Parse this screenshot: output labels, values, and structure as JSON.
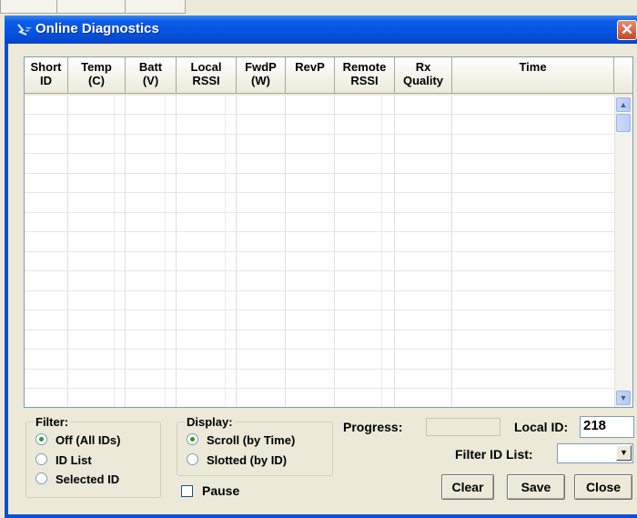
{
  "window": {
    "title": "Online Diagnostics",
    "close_glyph": "✕"
  },
  "table": {
    "columns": [
      {
        "line1": "Short",
        "line2": "ID"
      },
      {
        "line1": "Temp",
        "line2": "(C)"
      },
      {
        "line1": "Batt",
        "line2": "(V)"
      },
      {
        "line1": "Local",
        "line2": "RSSI"
      },
      {
        "line1": "FwdP",
        "line2": "(W)"
      },
      {
        "line1": "RevP",
        "line2": ""
      },
      {
        "line1": "Remote",
        "line2": "RSSI"
      },
      {
        "line1": "Rx",
        "line2": "Quality"
      },
      {
        "line1": "Time",
        "line2": ""
      }
    ],
    "rows": []
  },
  "filter": {
    "label": "Filter:",
    "options": [
      "Off (All IDs)",
      "ID List",
      "Selected ID"
    ],
    "selected": "Off (All IDs)"
  },
  "display": {
    "label": "Display:",
    "options": [
      "Scroll (by Time)",
      "Slotted (by ID)"
    ],
    "selected": "Scroll (by Time)"
  },
  "pause": {
    "label": "Pause",
    "checked": false
  },
  "progress": {
    "label": "Progress:",
    "value": 0
  },
  "local_id": {
    "label": "Local ID:",
    "value": "218"
  },
  "filter_id_list": {
    "label": "Filter ID List:",
    "value": ""
  },
  "buttons": {
    "clear": "Clear",
    "save": "Save",
    "close": "Close"
  },
  "icons": {
    "title_icon": "diagnostics-wave-icon",
    "scroll_up": "▲",
    "scroll_down": "▼",
    "combo_arrow": "▼"
  }
}
